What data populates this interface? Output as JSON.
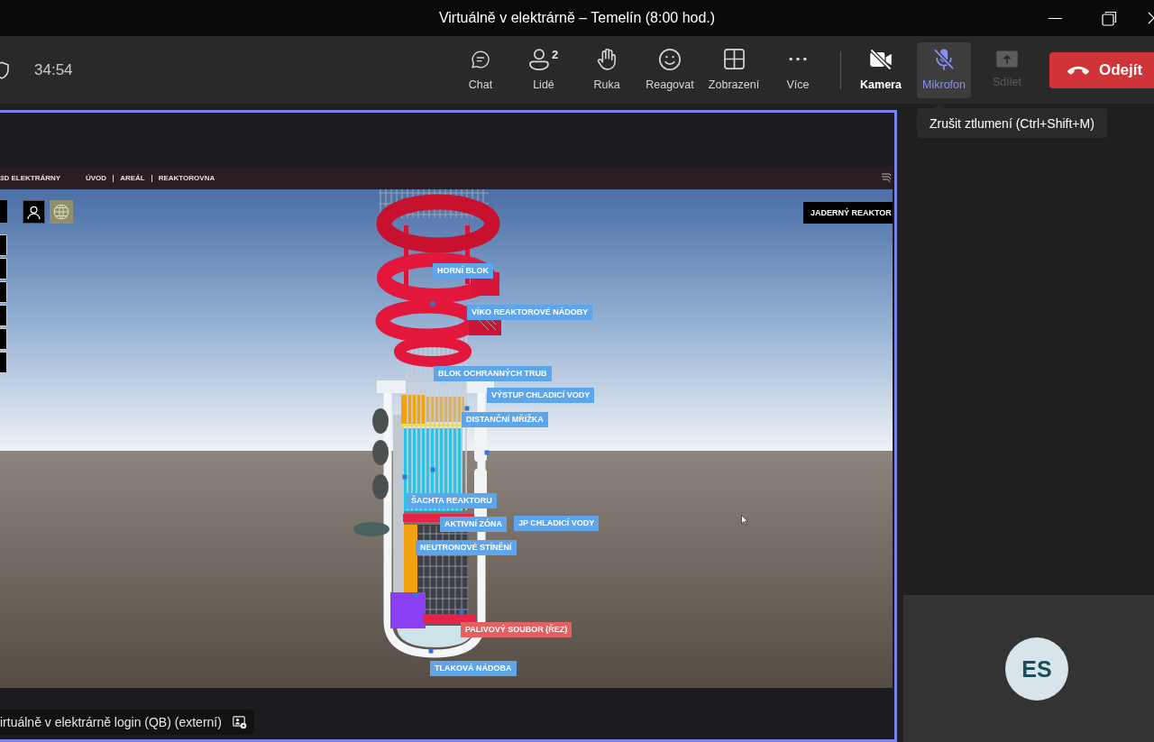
{
  "window": {
    "title": "Virtuálně v elektrárně – Temelín (8:00 hod.)"
  },
  "meeting_bar": {
    "timer": "34:54",
    "actions": [
      {
        "kind": "chat",
        "label": "Chat"
      },
      {
        "kind": "people",
        "label": "Lidé",
        "count": "2"
      },
      {
        "kind": "hand",
        "label": "Ruka"
      },
      {
        "kind": "react",
        "label": "Reagovat"
      },
      {
        "kind": "view",
        "label": "Zobrazení"
      },
      {
        "kind": "more",
        "label": "Více"
      }
    ],
    "camera": {
      "label": "Kamera",
      "on": false
    },
    "microphone": {
      "label": "Mikrofon",
      "on": false,
      "hovered": true
    },
    "share": {
      "label": "Sdílet",
      "disabled": true
    },
    "leave": {
      "label": "Odejít"
    }
  },
  "tooltip": {
    "text": "Zrušit ztlumení (Ctrl+Shift+M)"
  },
  "shared_screen": {
    "app_title": "3D ELEKTRÁRNY",
    "nav": [
      "ÚVOD",
      "AREÁL",
      "REAKTOROVNA"
    ],
    "panel_title": "JADERNÝ REAKTOR",
    "labels": [
      {
        "text": "HORNÍ BLOK",
        "selected": false
      },
      {
        "text": "VÍKO REAKTOROVÉ NÁDOBY",
        "selected": false
      },
      {
        "text": "BLOK OCHRANNÝCH TRUB",
        "selected": false
      },
      {
        "text": "VÝSTUP CHLADICÍ VODY",
        "selected": false
      },
      {
        "text": "DISTANČNÍ MŘÍŽKA",
        "selected": false
      },
      {
        "text": "ŠACHTA REAKTORU",
        "selected": false
      },
      {
        "text": "AKTIVNÍ ZÓNA",
        "selected": false
      },
      {
        "text": "JP CHLADICÍ VODY",
        "selected": false
      },
      {
        "text": "NEUTRONOVÉ STÍNĚNÍ",
        "selected": false
      },
      {
        "text": "PALIVOVÝ SOUBOR (ŘEZ)",
        "selected": true
      },
      {
        "text": "TLAKOVÁ NÁDOBA",
        "selected": false
      }
    ]
  },
  "presenter_caption": "irtuálně v elektrárně login (QB) (externí)",
  "participant": {
    "initials": "ES"
  }
}
